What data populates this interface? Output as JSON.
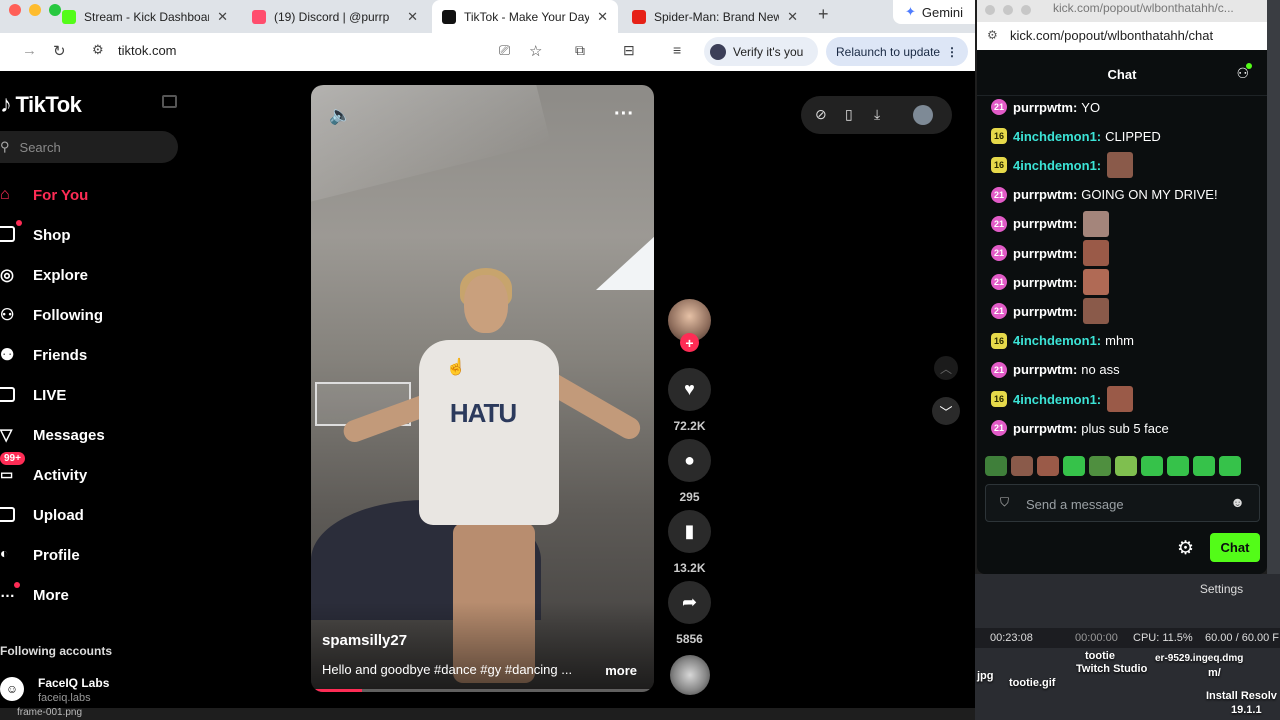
{
  "browser": {
    "tabs": [
      {
        "title": "Stream - Kick Dashboard",
        "favicon_color": "#53fc18",
        "active": false
      },
      {
        "title": "(19) Discord | @purrp",
        "favicon_color": "#ff4d6d",
        "active": false
      },
      {
        "title": "TikTok - Make Your Day",
        "favicon_color": "#111111",
        "active": true
      },
      {
        "title": "Spider-Man: Brand New Day",
        "favicon_color": "#e62117",
        "active": false
      }
    ],
    "gemini_label": "Gemini",
    "url": "tiktok.com",
    "verify_label": "Verify it's you",
    "relaunch_label": "Relaunch to update"
  },
  "tiktok": {
    "logo": "TikTok",
    "search_placeholder": "Search",
    "nav": [
      {
        "label": "For You",
        "icon": "home-icon",
        "active": true
      },
      {
        "label": "Shop",
        "icon": "shop-icon"
      },
      {
        "label": "Explore",
        "icon": "compass-icon"
      },
      {
        "label": "Following",
        "icon": "following-icon"
      },
      {
        "label": "Friends",
        "icon": "friends-icon"
      },
      {
        "label": "LIVE",
        "icon": "live-icon"
      },
      {
        "label": "Messages",
        "icon": "messages-icon"
      },
      {
        "label": "Activity",
        "icon": "activity-icon",
        "badge": "99+"
      },
      {
        "label": "Upload",
        "icon": "upload-icon"
      },
      {
        "label": "Profile",
        "icon": "profile-icon"
      },
      {
        "label": "More",
        "icon": "more-icon"
      }
    ],
    "following_title": "Following accounts",
    "following_accounts": [
      {
        "name": "FaceIQ Labs",
        "handle": "faceiq.labs"
      }
    ],
    "video": {
      "username": "spamsilly27",
      "description": "Hello and goodbye #dance #gy #dancing ...",
      "more_label": "more",
      "shirt_text": "HATU",
      "progress": 0.15
    },
    "actions": {
      "likes": "72.2K",
      "comments": "295",
      "saves": "13.2K",
      "shares": "5856"
    }
  },
  "kick_popout": {
    "window_title": "kick.com/popout/wlbonthatahh/c...",
    "url": "kick.com/popout/wlbonthatahh/chat",
    "header": "Chat",
    "messages": [
      {
        "badge": "21",
        "badge_color": "pink",
        "user": "purrpwtm:",
        "user_color": "#ffffff",
        "text": "YO"
      },
      {
        "badge": "16",
        "badge_color": "yellow",
        "user": "4inchdemon1:",
        "user_color": "#3ce3d6",
        "text": "CLIPPED"
      },
      {
        "badge": "16",
        "badge_color": "yellow",
        "user": "4inchdemon1:",
        "user_color": "#3ce3d6",
        "text": "",
        "emote": true
      },
      {
        "badge": "21",
        "badge_color": "pink",
        "user": "purrpwtm:",
        "user_color": "#ffffff",
        "text": "GOING ON MY DRIVE!"
      },
      {
        "badge": "21",
        "badge_color": "pink",
        "user": "purrpwtm:",
        "user_color": "#ffffff",
        "text": "",
        "emote": true
      },
      {
        "badge": "21",
        "badge_color": "pink",
        "user": "purrpwtm:",
        "user_color": "#ffffff",
        "text": "",
        "emote": true
      },
      {
        "badge": "21",
        "badge_color": "pink",
        "user": "purrpwtm:",
        "user_color": "#ffffff",
        "text": "",
        "emote": true
      },
      {
        "badge": "21",
        "badge_color": "pink",
        "user": "purrpwtm:",
        "user_color": "#ffffff",
        "text": "",
        "emote": true
      },
      {
        "badge": "16",
        "badge_color": "yellow",
        "user": "4inchdemon1:",
        "user_color": "#3ce3d6",
        "text": "mhm"
      },
      {
        "badge": "21",
        "badge_color": "pink",
        "user": "purrpwtm:",
        "user_color": "#ffffff",
        "text": "no ass"
      },
      {
        "badge": "16",
        "badge_color": "yellow",
        "user": "4inchdemon1:",
        "user_color": "#3ce3d6",
        "text": "",
        "emote": true
      },
      {
        "badge": "21",
        "badge_color": "pink",
        "user": "purrpwtm:",
        "user_color": "#ffffff",
        "text": "plus sub 5 face"
      }
    ],
    "input_placeholder": "Send a message",
    "send_label": "Chat",
    "accent": "#53fc18"
  },
  "desktop": {
    "settings_tab": "Settings",
    "obs_time": "00:23:08",
    "obs_time2": "00:00:00",
    "obs_cpu": "CPU: 11.5%",
    "obs_fps": "60.00 / 60.00 F",
    "files": [
      "jpg",
      "tootie.gif",
      "tootie",
      "Twitch Studio",
      "er-9529.ingeq.dmg",
      "m/",
      "Install Resolv",
      "19.1.1"
    ],
    "bottom_file": "frame-001.png"
  }
}
